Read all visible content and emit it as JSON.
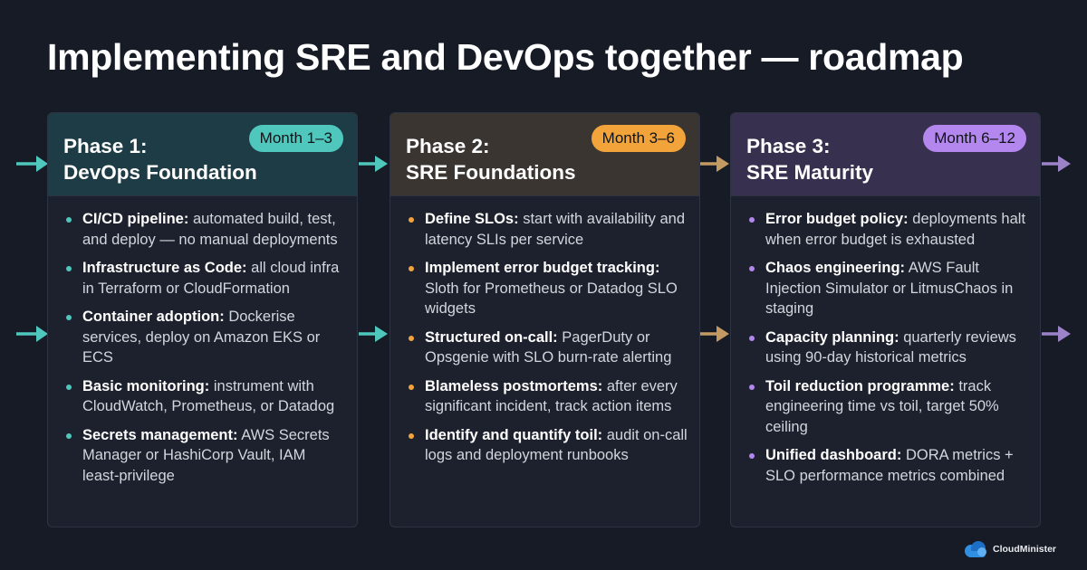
{
  "title": "Implementing SRE and DevOps together — roadmap",
  "colors": {
    "background": "#161b26",
    "phase1_accent": "#4fc7bd",
    "phase2_accent": "#f2a43a",
    "phase3_accent": "#b387ee",
    "phase1_header": "#1d3c45",
    "phase2_header": "#3a3530",
    "phase3_header": "#37304f"
  },
  "phases": [
    {
      "title_line1": "Phase 1:",
      "title_line2": "DevOps Foundation",
      "badge": "Month 1–3",
      "items": [
        {
          "bold": "CI/CD pipeline:",
          "text": "automated build, test, and deploy — no manual deployments"
        },
        {
          "bold": "Infrastructure as Code:",
          "text": "all cloud infra in Terraform or CloudFormation"
        },
        {
          "bold": "Container adoption:",
          "text": "Dockerise services, deploy on Amazon EKS or ECS"
        },
        {
          "bold": "Basic monitoring:",
          "text": "instrument with CloudWatch, Prometheus, or Datadog"
        },
        {
          "bold": "Secrets management:",
          "text": "AWS Secrets Manager or HashiCorp Vault, IAM least-privilege"
        }
      ]
    },
    {
      "title_line1": "Phase 2:",
      "title_line2": "SRE Foundations",
      "badge": "Month 3–6",
      "items": [
        {
          "bold": "Define SLOs:",
          "text": "start with availability and latency SLIs per service"
        },
        {
          "bold": "Implement error budget tracking:",
          "text": "Sloth for Prometheus or Datadog SLO widgets"
        },
        {
          "bold": "Structured on-call:",
          "text": "PagerDuty or Opsgenie with SLO burn-rate alerting"
        },
        {
          "bold": "Blameless postmortems:",
          "text": "after every significant incident, track action items"
        },
        {
          "bold": "Identify and quantify toil:",
          "text": "audit on-call logs and deployment runbooks"
        }
      ]
    },
    {
      "title_line1": "Phase 3:",
      "title_line2": "SRE Maturity",
      "badge": "Month 6–12",
      "items": [
        {
          "bold": "Error budget policy:",
          "text": "deployments halt when error budget is exhausted"
        },
        {
          "bold": "Chaos engineering:",
          "text": "AWS Fault Injection Simulator or LitmusChaos in staging"
        },
        {
          "bold": "Capacity planning:",
          "text": "quarterly reviews using 90-day historical metrics"
        },
        {
          "bold": "Toil reduction programme:",
          "text": "track engineering time vs toil, target 50% ceiling"
        },
        {
          "bold": "Unified dashboard:",
          "text": "DORA metrics + SLO performance metrics combined"
        }
      ]
    }
  ],
  "logo": {
    "text": "CloudMinister",
    "icon": "cloud-logo-icon"
  }
}
